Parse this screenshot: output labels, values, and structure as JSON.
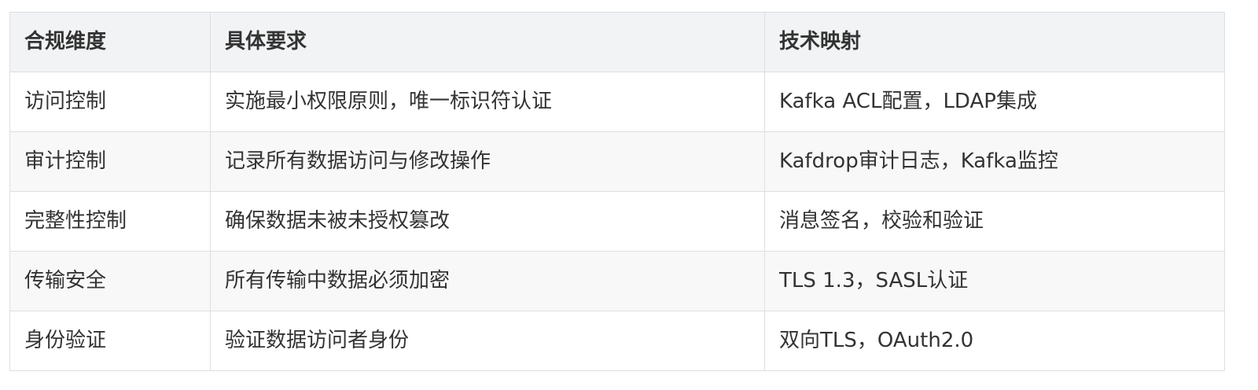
{
  "table": {
    "headers": [
      "合规维度",
      "具体要求",
      "技术映射"
    ],
    "rows": [
      [
        "访问控制",
        "实施最小权限原则，唯一标识符认证",
        "Kafka ACL配置，LDAP集成"
      ],
      [
        "审计控制",
        "记录所有数据访问与修改操作",
        "Kafdrop审计日志，Kafka监控"
      ],
      [
        "完整性控制",
        "确保数据未被未授权篡改",
        "消息签名，校验和验证"
      ],
      [
        "传输安全",
        "所有传输中数据必须加密",
        "TLS 1.3，SASL认证"
      ],
      [
        "身份验证",
        "验证数据访问者身份",
        "双向TLS，OAuth2.0"
      ]
    ]
  },
  "colors": {
    "header_bg": "#f1f3f5",
    "stripe_bg": "#f8f8f8",
    "border": "#dcdfe3",
    "text": "#333333"
  }
}
